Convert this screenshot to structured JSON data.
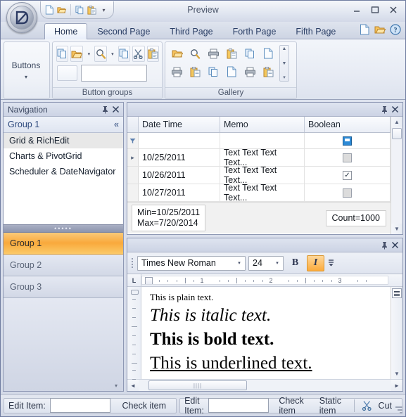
{
  "window": {
    "title": "Preview",
    "app_button": "D",
    "minimize": "minimize-icon",
    "maximize": "maximize-icon",
    "close": "close-icon"
  },
  "quick_access": {
    "items": [
      {
        "name": "new-document-icon",
        "label": "New"
      },
      {
        "name": "open-folder-icon",
        "label": "Open"
      },
      {
        "name": "copy-icon",
        "label": "Copy"
      },
      {
        "name": "paste-icon",
        "label": "Paste"
      }
    ],
    "overflow_label": "▾"
  },
  "ribbon": {
    "tabs": [
      {
        "label": "Home",
        "active": true
      },
      {
        "label": "Second Page",
        "active": false
      },
      {
        "label": "Third Page",
        "active": false
      },
      {
        "label": "Forth Page",
        "active": false
      },
      {
        "label": "Fifth Page",
        "active": false
      }
    ],
    "tab_right_icons": [
      "new-document-icon",
      "open-folder-icon",
      "help-icon"
    ],
    "groups": [
      {
        "caption": "",
        "big_button": {
          "label": "Buttons",
          "arrow": "▾"
        }
      },
      {
        "caption": "Button groups",
        "tools": [
          "copy-icon",
          "open-folder-icon",
          "zoom-icon",
          "copy-icon",
          "cut-icon",
          "paste-icon"
        ],
        "row2": {
          "small_button": "",
          "textbox_value": ""
        }
      },
      {
        "caption": "Gallery",
        "items": [
          "open-folder-icon",
          "zoom-icon",
          "print-icon",
          "paste-icon",
          "copy-icon",
          "new-document-icon",
          "print-icon",
          "paste-icon",
          "copy-icon",
          "new-document-icon",
          "print-icon",
          "paste-icon"
        ],
        "scroll": {
          "up": "▲",
          "down": "▼",
          "more": "▾"
        }
      }
    ]
  },
  "navigation": {
    "header": {
      "title": "Navigation",
      "pin": "pin-icon",
      "close": "close-icon"
    },
    "group_header": {
      "title": "Group 1",
      "collapse": "«"
    },
    "items": [
      {
        "label": "Grid & RichEdit",
        "selected": true
      },
      {
        "label": "Charts & PivotGrid",
        "selected": false
      },
      {
        "label": "Scheduler & DateNavigator",
        "selected": false
      }
    ],
    "splitter_dots": "•••••",
    "groups": [
      {
        "label": "Group 1",
        "active": true
      },
      {
        "label": "Group 2",
        "active": false
      },
      {
        "label": "Group 3",
        "active": false
      }
    ],
    "overflow_arrow": "▾"
  },
  "grid_panel": {
    "header": {
      "title": "",
      "pin": "pin-icon",
      "close": "close-icon"
    },
    "columns": [
      "Date Time",
      "Memo",
      "Boolean"
    ],
    "filter_row": {
      "icon": "filter-icon",
      "boolean_state": "indeterminate"
    },
    "rows": [
      {
        "indicator": "▸",
        "date_time": "10/25/2011",
        "memo": "Text Text Text Text...",
        "boolean": false
      },
      {
        "indicator": "",
        "date_time": "10/26/2011",
        "memo": "Text Text Text Text...",
        "boolean": true
      },
      {
        "indicator": "",
        "date_time": "10/27/2011",
        "memo": "Text Text Text Text...",
        "boolean": false
      }
    ],
    "summary": {
      "left_line1": "Min=10/25/2011",
      "left_line2": "Max=7/20/2014",
      "right": "Count=1000"
    },
    "scroll": {
      "up": "▲",
      "down": "▼"
    }
  },
  "richedit_panel": {
    "header": {
      "title": "",
      "pin": "pin-icon",
      "close": "close-icon"
    },
    "toolbar": {
      "font_name": "Times New Roman",
      "font_size": "24",
      "bold_label": "B",
      "italic_label": "I",
      "italic_active": true,
      "overflow": "▾"
    },
    "ruler": {
      "corner_label": "L",
      "numbers": [
        "1",
        "2",
        "3"
      ]
    },
    "document": {
      "line1": "This is plain text.",
      "line2": "This is italic text.",
      "line3": "This is bold text.",
      "line4": "This is underlined text."
    },
    "hscroll": {
      "left": "◄",
      "right": "►"
    },
    "vscroll": {
      "up": "▲",
      "down": "▼"
    }
  },
  "statusbar": {
    "left_panel": {
      "label": "Edit Item:",
      "value": "",
      "check_item": "Check item"
    },
    "right_panel": {
      "label": "Edit Item:",
      "value": "",
      "check_item": "Check item",
      "static_item": "Static item",
      "cut_label": "Cut",
      "cut_icon": "cut-icon"
    }
  },
  "colors": {
    "accent_orange": "#f9a93c",
    "window_border": "#6f7ca0",
    "selection_blue": "#2c8ad6",
    "tab_text": "#2b3f66"
  }
}
